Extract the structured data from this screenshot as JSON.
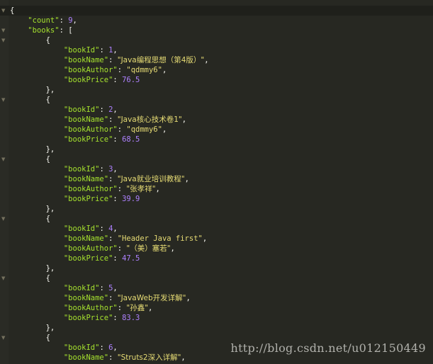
{
  "colors": {
    "background": "#272822",
    "gutter": "#2a2b25",
    "key": "#a6e22e",
    "string": "#e6db74",
    "number": "#ae81ff",
    "punctuation": "#f8f8f2",
    "fold_marker": "#75715e"
  },
  "fold_icon": "triangle-down-icon",
  "lines": [
    {
      "fold": true,
      "segments": [
        {
          "t": "{",
          "c": "punc"
        }
      ]
    },
    {
      "fold": false,
      "segments": [
        {
          "t": "    ",
          "c": "punc"
        },
        {
          "t": "\"count\"",
          "c": "key"
        },
        {
          "t": ": ",
          "c": "punc"
        },
        {
          "t": "9",
          "c": "num"
        },
        {
          "t": ",",
          "c": "punc"
        }
      ]
    },
    {
      "fold": true,
      "segments": [
        {
          "t": "    ",
          "c": "punc"
        },
        {
          "t": "\"books\"",
          "c": "key"
        },
        {
          "t": ": [",
          "c": "punc"
        }
      ]
    },
    {
      "fold": true,
      "segments": [
        {
          "t": "        {",
          "c": "punc"
        }
      ]
    },
    {
      "fold": false,
      "segments": [
        {
          "t": "            ",
          "c": "punc"
        },
        {
          "t": "\"bookId\"",
          "c": "key"
        },
        {
          "t": ": ",
          "c": "punc"
        },
        {
          "t": "1",
          "c": "num"
        },
        {
          "t": ",",
          "c": "punc"
        }
      ]
    },
    {
      "fold": false,
      "segments": [
        {
          "t": "            ",
          "c": "punc"
        },
        {
          "t": "\"bookName\"",
          "c": "key"
        },
        {
          "t": ": ",
          "c": "punc"
        },
        {
          "t": "\"Java编程思想（第4版）\"",
          "c": "str"
        },
        {
          "t": ",",
          "c": "punc"
        }
      ]
    },
    {
      "fold": false,
      "segments": [
        {
          "t": "            ",
          "c": "punc"
        },
        {
          "t": "\"bookAuthor\"",
          "c": "key"
        },
        {
          "t": ": ",
          "c": "punc"
        },
        {
          "t": "\"qdmmy6\"",
          "c": "str"
        },
        {
          "t": ",",
          "c": "punc"
        }
      ]
    },
    {
      "fold": false,
      "segments": [
        {
          "t": "            ",
          "c": "punc"
        },
        {
          "t": "\"bookPrice\"",
          "c": "key"
        },
        {
          "t": ": ",
          "c": "punc"
        },
        {
          "t": "76.5",
          "c": "num"
        }
      ]
    },
    {
      "fold": false,
      "segments": [
        {
          "t": "        },",
          "c": "punc"
        }
      ]
    },
    {
      "fold": true,
      "segments": [
        {
          "t": "        {",
          "c": "punc"
        }
      ]
    },
    {
      "fold": false,
      "segments": [
        {
          "t": "            ",
          "c": "punc"
        },
        {
          "t": "\"bookId\"",
          "c": "key"
        },
        {
          "t": ": ",
          "c": "punc"
        },
        {
          "t": "2",
          "c": "num"
        },
        {
          "t": ",",
          "c": "punc"
        }
      ]
    },
    {
      "fold": false,
      "segments": [
        {
          "t": "            ",
          "c": "punc"
        },
        {
          "t": "\"bookName\"",
          "c": "key"
        },
        {
          "t": ": ",
          "c": "punc"
        },
        {
          "t": "\"Java核心技术卷1\"",
          "c": "str"
        },
        {
          "t": ",",
          "c": "punc"
        }
      ]
    },
    {
      "fold": false,
      "segments": [
        {
          "t": "            ",
          "c": "punc"
        },
        {
          "t": "\"bookAuthor\"",
          "c": "key"
        },
        {
          "t": ": ",
          "c": "punc"
        },
        {
          "t": "\"qdmmy6\"",
          "c": "str"
        },
        {
          "t": ",",
          "c": "punc"
        }
      ]
    },
    {
      "fold": false,
      "segments": [
        {
          "t": "            ",
          "c": "punc"
        },
        {
          "t": "\"bookPrice\"",
          "c": "key"
        },
        {
          "t": ": ",
          "c": "punc"
        },
        {
          "t": "68.5",
          "c": "num"
        }
      ]
    },
    {
      "fold": false,
      "segments": [
        {
          "t": "        },",
          "c": "punc"
        }
      ]
    },
    {
      "fold": true,
      "segments": [
        {
          "t": "        {",
          "c": "punc"
        }
      ]
    },
    {
      "fold": false,
      "segments": [
        {
          "t": "            ",
          "c": "punc"
        },
        {
          "t": "\"bookId\"",
          "c": "key"
        },
        {
          "t": ": ",
          "c": "punc"
        },
        {
          "t": "3",
          "c": "num"
        },
        {
          "t": ",",
          "c": "punc"
        }
      ]
    },
    {
      "fold": false,
      "segments": [
        {
          "t": "            ",
          "c": "punc"
        },
        {
          "t": "\"bookName\"",
          "c": "key"
        },
        {
          "t": ": ",
          "c": "punc"
        },
        {
          "t": "\"Java就业培训教程\"",
          "c": "str"
        },
        {
          "t": ",",
          "c": "punc"
        }
      ]
    },
    {
      "fold": false,
      "segments": [
        {
          "t": "            ",
          "c": "punc"
        },
        {
          "t": "\"bookAuthor\"",
          "c": "key"
        },
        {
          "t": ": ",
          "c": "punc"
        },
        {
          "t": "\"张孝祥\"",
          "c": "str"
        },
        {
          "t": ",",
          "c": "punc"
        }
      ]
    },
    {
      "fold": false,
      "segments": [
        {
          "t": "            ",
          "c": "punc"
        },
        {
          "t": "\"bookPrice\"",
          "c": "key"
        },
        {
          "t": ": ",
          "c": "punc"
        },
        {
          "t": "39.9",
          "c": "num"
        }
      ]
    },
    {
      "fold": false,
      "segments": [
        {
          "t": "        },",
          "c": "punc"
        }
      ]
    },
    {
      "fold": true,
      "segments": [
        {
          "t": "        {",
          "c": "punc"
        }
      ]
    },
    {
      "fold": false,
      "segments": [
        {
          "t": "            ",
          "c": "punc"
        },
        {
          "t": "\"bookId\"",
          "c": "key"
        },
        {
          "t": ": ",
          "c": "punc"
        },
        {
          "t": "4",
          "c": "num"
        },
        {
          "t": ",",
          "c": "punc"
        }
      ]
    },
    {
      "fold": false,
      "segments": [
        {
          "t": "            ",
          "c": "punc"
        },
        {
          "t": "\"bookName\"",
          "c": "key"
        },
        {
          "t": ": ",
          "c": "punc"
        },
        {
          "t": "\"Header Java first\"",
          "c": "str"
        },
        {
          "t": ",",
          "c": "punc"
        }
      ]
    },
    {
      "fold": false,
      "segments": [
        {
          "t": "            ",
          "c": "punc"
        },
        {
          "t": "\"bookAuthor\"",
          "c": "key"
        },
        {
          "t": ": ",
          "c": "punc"
        },
        {
          "t": "\"（美）塞若\"",
          "c": "str"
        },
        {
          "t": ",",
          "c": "punc"
        }
      ]
    },
    {
      "fold": false,
      "segments": [
        {
          "t": "            ",
          "c": "punc"
        },
        {
          "t": "\"bookPrice\"",
          "c": "key"
        },
        {
          "t": ": ",
          "c": "punc"
        },
        {
          "t": "47.5",
          "c": "num"
        }
      ]
    },
    {
      "fold": false,
      "segments": [
        {
          "t": "        },",
          "c": "punc"
        }
      ]
    },
    {
      "fold": true,
      "segments": [
        {
          "t": "        {",
          "c": "punc"
        }
      ]
    },
    {
      "fold": false,
      "segments": [
        {
          "t": "            ",
          "c": "punc"
        },
        {
          "t": "\"bookId\"",
          "c": "key"
        },
        {
          "t": ": ",
          "c": "punc"
        },
        {
          "t": "5",
          "c": "num"
        },
        {
          "t": ",",
          "c": "punc"
        }
      ]
    },
    {
      "fold": false,
      "segments": [
        {
          "t": "            ",
          "c": "punc"
        },
        {
          "t": "\"bookName\"",
          "c": "key"
        },
        {
          "t": ": ",
          "c": "punc"
        },
        {
          "t": "\"JavaWeb开发详解\"",
          "c": "str"
        },
        {
          "t": ",",
          "c": "punc"
        }
      ]
    },
    {
      "fold": false,
      "segments": [
        {
          "t": "            ",
          "c": "punc"
        },
        {
          "t": "\"bookAuthor\"",
          "c": "key"
        },
        {
          "t": ": ",
          "c": "punc"
        },
        {
          "t": "\"孙鑫\"",
          "c": "str"
        },
        {
          "t": ",",
          "c": "punc"
        }
      ]
    },
    {
      "fold": false,
      "segments": [
        {
          "t": "            ",
          "c": "punc"
        },
        {
          "t": "\"bookPrice\"",
          "c": "key"
        },
        {
          "t": ": ",
          "c": "punc"
        },
        {
          "t": "83.3",
          "c": "num"
        }
      ]
    },
    {
      "fold": false,
      "segments": [
        {
          "t": "        },",
          "c": "punc"
        }
      ]
    },
    {
      "fold": true,
      "segments": [
        {
          "t": "        {",
          "c": "punc"
        }
      ]
    },
    {
      "fold": false,
      "segments": [
        {
          "t": "            ",
          "c": "punc"
        },
        {
          "t": "\"bookId\"",
          "c": "key"
        },
        {
          "t": ": ",
          "c": "punc"
        },
        {
          "t": "6",
          "c": "num"
        },
        {
          "t": ",",
          "c": "punc"
        }
      ]
    },
    {
      "fold": false,
      "segments": [
        {
          "t": "            ",
          "c": "punc"
        },
        {
          "t": "\"bookName\"",
          "c": "key"
        },
        {
          "t": ": ",
          "c": "punc"
        },
        {
          "t": "\"Struts2深入详解\"",
          "c": "str"
        },
        {
          "t": ",",
          "c": "punc"
        }
      ]
    }
  ],
  "watermark": {
    "text": "http://blog.csdn.net/u012150449"
  }
}
